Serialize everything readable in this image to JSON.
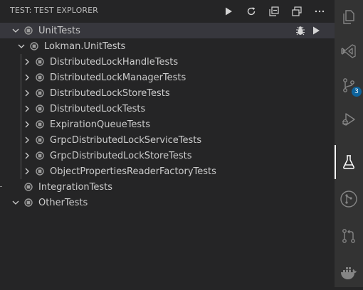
{
  "panel": {
    "title": "TEST: TEST EXPLORER",
    "actions": [
      {
        "icon": "run-all-icon"
      },
      {
        "icon": "refresh-icon"
      },
      {
        "icon": "collapse-all-icon"
      },
      {
        "icon": "show-output-icon"
      },
      {
        "icon": "more-actions-icon"
      }
    ]
  },
  "tree": {
    "root": {
      "label": "UnitTests",
      "expanded": true,
      "row_actions": [
        "debug-icon",
        "run-icon"
      ]
    },
    "project": {
      "label": "Lokman.UnitTests",
      "expanded": true
    },
    "tests": [
      {
        "label": "DistributedLockHandleTests"
      },
      {
        "label": "DistributedLockManagerTests"
      },
      {
        "label": "DistributedLockStoreTests"
      },
      {
        "label": "DistributedLockTests"
      },
      {
        "label": "ExpirationQueueTests"
      },
      {
        "label": "GrpcDistributedLockServiceTests"
      },
      {
        "label": "GrpcDistributedLockStoreTests"
      },
      {
        "label": "ObjectPropertiesReaderFactoryTests"
      }
    ],
    "integration": {
      "label": "IntegrationTests"
    },
    "other": {
      "label": "OtherTests",
      "expanded": true
    }
  },
  "activity_bar": {
    "items": [
      {
        "icon": "explorer-icon"
      },
      {
        "icon": "visual-studio-icon"
      },
      {
        "icon": "source-control-icon",
        "badge": "3"
      },
      {
        "icon": "run-debug-icon"
      },
      {
        "icon": "testing-icon",
        "active": true
      },
      {
        "icon": "git-graph-icon"
      },
      {
        "icon": "pull-requests-icon"
      },
      {
        "icon": "docker-icon"
      }
    ]
  },
  "colors": {
    "sidebar_bg": "#252526",
    "activity_bar_bg": "#333333",
    "selection_bg": "#37373d",
    "text": "#cccccc",
    "badge_bg": "#0e639c"
  }
}
